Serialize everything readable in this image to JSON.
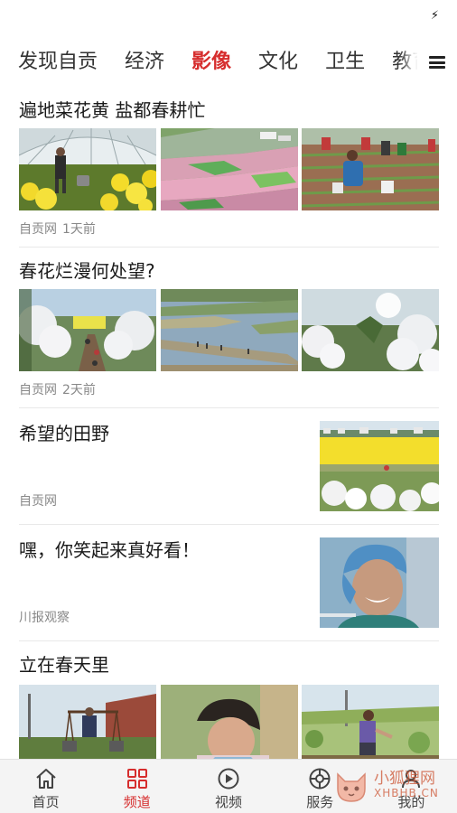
{
  "status_bar": {
    "icon": "flash-icon",
    "glyph": "⚡"
  },
  "tabs": [
    {
      "label": "发现自贡",
      "active": false
    },
    {
      "label": "经济",
      "active": false
    },
    {
      "label": "影像",
      "active": true
    },
    {
      "label": "文化",
      "active": false
    },
    {
      "label": "卫生",
      "active": false
    },
    {
      "label": "教育",
      "active": false
    }
  ],
  "articles": [
    {
      "title": "遍地菜花黄 盐都春耕忙",
      "source": "自贡网",
      "time": "1天前"
    },
    {
      "title": "春花烂漫何处望?",
      "source": "自贡网",
      "time": "2天前"
    },
    {
      "title": "希望的田野",
      "source": "自贡网"
    },
    {
      "title": "嘿，你笑起来真好看！",
      "source": "川报观察"
    },
    {
      "title": "立在春天里"
    }
  ],
  "bottom_nav": [
    {
      "label": "首页",
      "icon": "home-icon"
    },
    {
      "label": "频道",
      "icon": "channel-grid-icon",
      "active": true
    },
    {
      "label": "视频",
      "icon": "video-play-icon"
    },
    {
      "label": "服务",
      "icon": "service-icon"
    },
    {
      "label": "我的",
      "icon": "user-icon"
    }
  ],
  "watermark": {
    "cn": "小狐狸网",
    "en": "XHBHB.CN"
  },
  "colors": {
    "accent": "#d62d2d",
    "meta": "#888888",
    "divider": "#e8e8e8"
  }
}
